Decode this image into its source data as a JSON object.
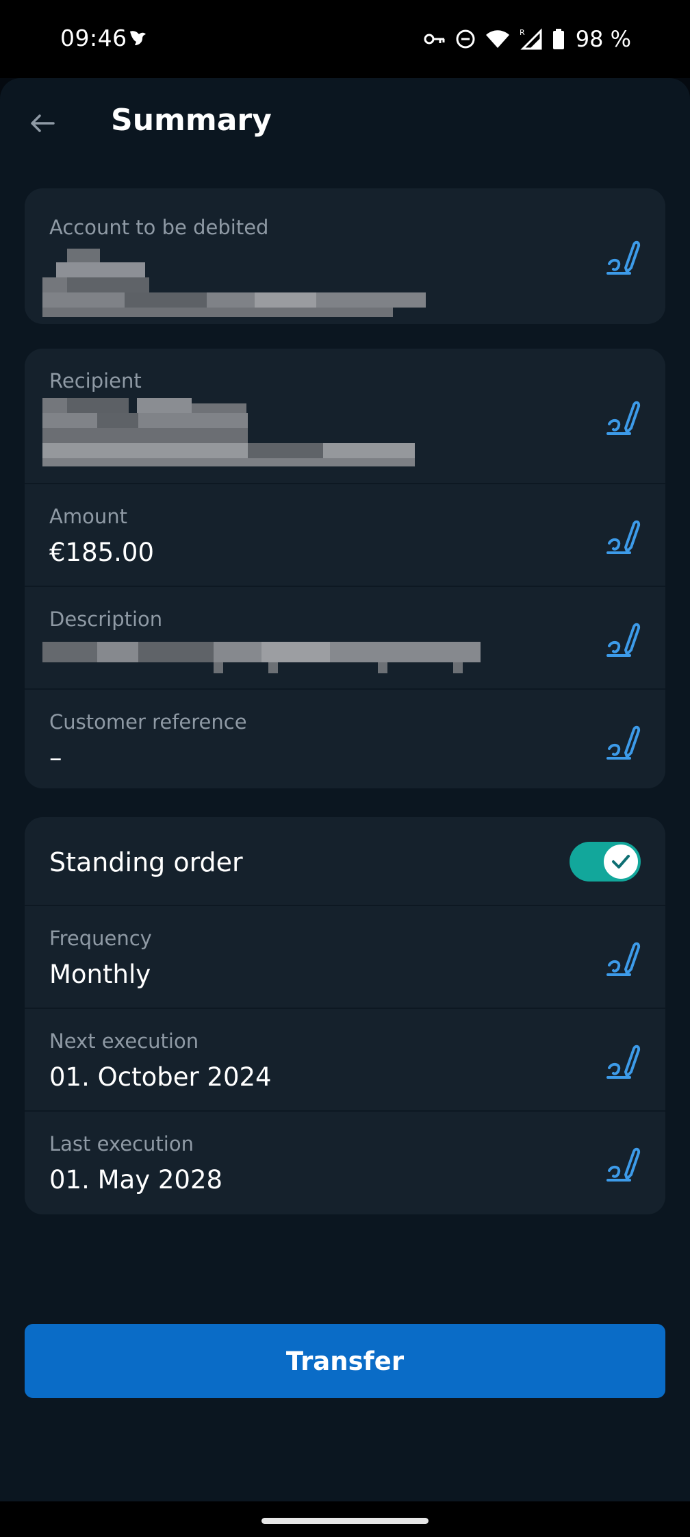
{
  "status_bar": {
    "time": "09:46",
    "battery_percent": "98 %",
    "icons": [
      "bird-notification-icon",
      "key-icon",
      "dnd-icon",
      "wifi-icon",
      "signal-icon",
      "battery-icon"
    ]
  },
  "header": {
    "title": "Summary",
    "back_icon": "arrow-left-icon"
  },
  "debit_card": {
    "label": "Account to be debited",
    "value_redacted": true
  },
  "details_card": {
    "recipient": {
      "label": "Recipient",
      "value_redacted": true
    },
    "amount": {
      "label": "Amount",
      "value": "€185.00"
    },
    "description": {
      "label": "Description",
      "value_redacted": true
    },
    "customer_reference": {
      "label": "Customer reference",
      "value": "–"
    }
  },
  "standing_card": {
    "standing_order": {
      "label": "Standing order",
      "enabled": true
    },
    "frequency": {
      "label": "Frequency",
      "value": "Monthly"
    },
    "next_execution": {
      "label": "Next execution",
      "value": "01. October 2024"
    },
    "last_execution": {
      "label": "Last execution",
      "value": "01. May 2028"
    }
  },
  "actions": {
    "transfer_label": "Transfer"
  },
  "colors": {
    "background": "#0b1620",
    "card": "#15212c",
    "accent_icon": "#3d9be9",
    "toggle_on": "#12a79b",
    "primary_button": "#0a6cc7"
  }
}
